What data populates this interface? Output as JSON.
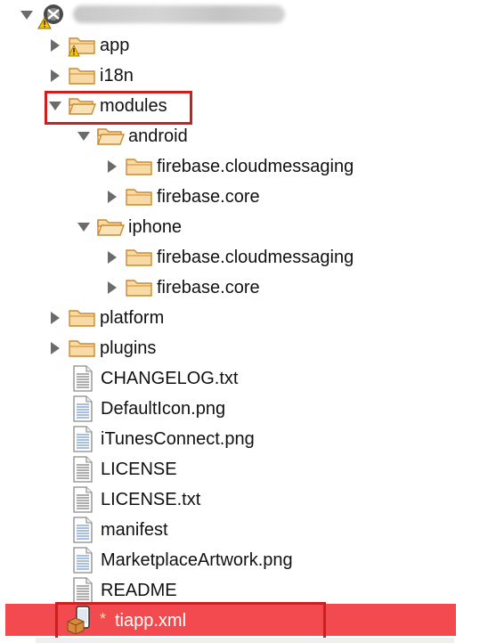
{
  "root": {
    "title": "",
    "icon": "project-warning-icon"
  },
  "items": [
    {
      "id": "app",
      "label": "app",
      "kind": "folder",
      "state": "collapsed",
      "depth": 1,
      "warning": true
    },
    {
      "id": "i18n",
      "label": "i18n",
      "kind": "folder",
      "state": "collapsed",
      "depth": 1
    },
    {
      "id": "modules",
      "label": "modules",
      "kind": "folder",
      "state": "expanded",
      "depth": 1,
      "highlighted": true
    },
    {
      "id": "android",
      "label": "android",
      "kind": "folder",
      "state": "expanded",
      "depth": 2
    },
    {
      "id": "android-cloudmessaging",
      "label": "firebase.cloudmessaging",
      "kind": "folder",
      "state": "collapsed",
      "depth": 3
    },
    {
      "id": "android-core",
      "label": "firebase.core",
      "kind": "folder",
      "state": "collapsed",
      "depth": 3
    },
    {
      "id": "iphone",
      "label": "iphone",
      "kind": "folder",
      "state": "expanded",
      "depth": 2
    },
    {
      "id": "iphone-cloudmessaging",
      "label": "firebase.cloudmessaging",
      "kind": "folder",
      "state": "collapsed",
      "depth": 3
    },
    {
      "id": "iphone-core",
      "label": "firebase.core",
      "kind": "folder",
      "state": "collapsed",
      "depth": 3
    },
    {
      "id": "platform",
      "label": "platform",
      "kind": "folder",
      "state": "collapsed",
      "depth": 1
    },
    {
      "id": "plugins",
      "label": "plugins",
      "kind": "folder",
      "state": "collapsed",
      "depth": 1
    },
    {
      "id": "changelog",
      "label": "CHANGELOG.txt",
      "kind": "text-file",
      "depth": 1
    },
    {
      "id": "defaulticon",
      "label": "DefaultIcon.png",
      "kind": "image-file",
      "depth": 1
    },
    {
      "id": "itunesconnect",
      "label": "iTunesConnect.png",
      "kind": "image-file",
      "depth": 1
    },
    {
      "id": "license",
      "label": "LICENSE",
      "kind": "text-file",
      "depth": 1
    },
    {
      "id": "license-txt",
      "label": "LICENSE.txt",
      "kind": "text-file",
      "depth": 1
    },
    {
      "id": "manifest",
      "label": "manifest",
      "kind": "image-file",
      "depth": 1
    },
    {
      "id": "marketplace",
      "label": "MarketplaceArtwork.png",
      "kind": "image-file",
      "depth": 1
    },
    {
      "id": "readme",
      "label": "README",
      "kind": "text-file",
      "depth": 1
    },
    {
      "id": "tiapp",
      "label": "tiapp.xml",
      "kind": "tiapp-file",
      "depth": 1,
      "selected": true,
      "highlighted": true,
      "dirty_marker": "*"
    }
  ],
  "colors": {
    "selection": "#f24a4f",
    "highlight_border": "#cc1f1f",
    "folder_fill": "#f9d9a4",
    "folder_stroke": "#c98a2e",
    "file_stroke": "#8a8a8a",
    "text": "#111111"
  }
}
